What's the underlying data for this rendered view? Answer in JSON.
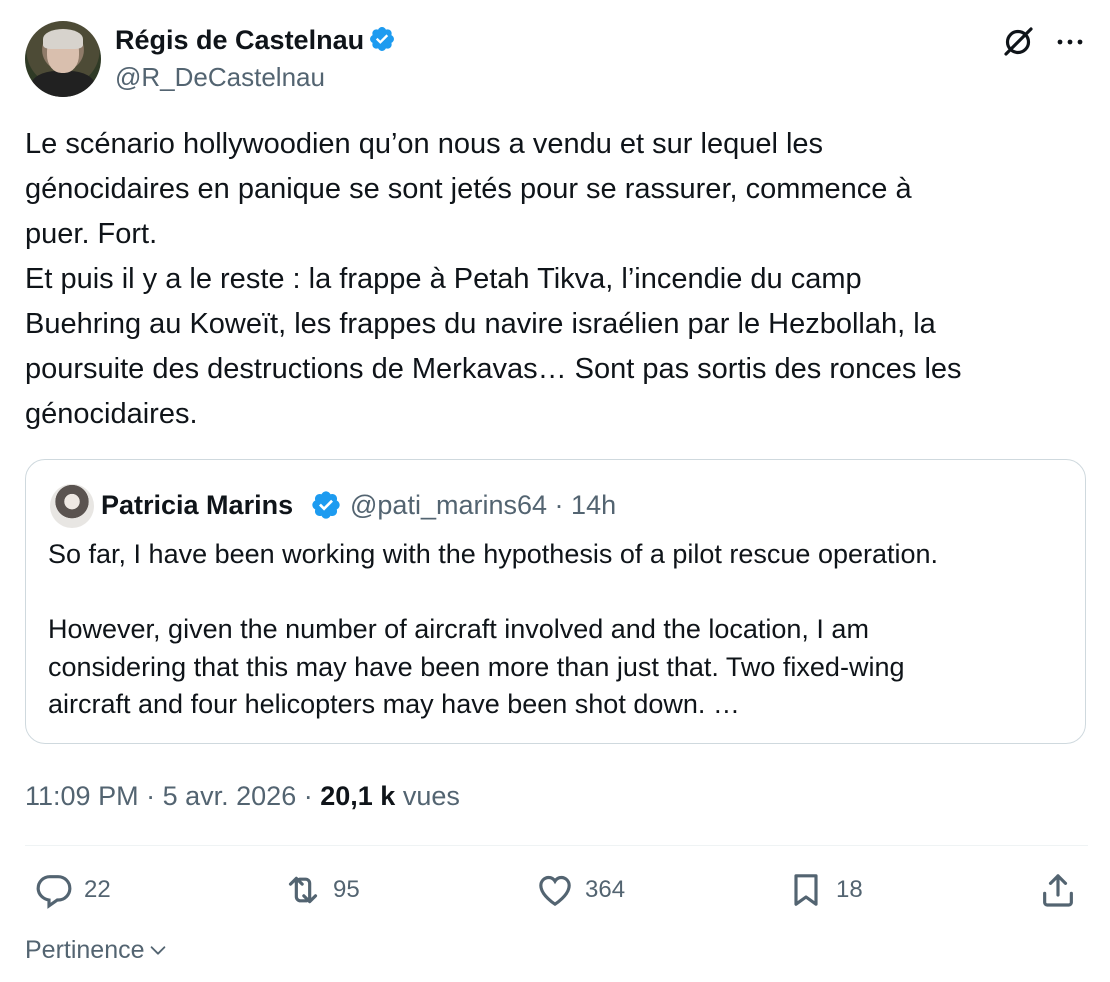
{
  "author": {
    "name": "Régis de Castelnau",
    "handle": "@R_DeCastelnau",
    "verified_color": "#1d9bf0"
  },
  "tweet": {
    "text": "Le scénario hollywoodien qu’on nous a vendu et sur lequel les\ngénocidaires en panique se sont jetés pour se rassurer, commence à\npuer. Fort.\nEt puis il y a le reste : la frappe à Petah Tikva, l’incendie du camp\nBuehring au Koweït, les frappes du navire israélien par le Hezbollah, la\npoursuite des destructions de Merkavas… Sont pas sortis des ronces les\ngénocidaires."
  },
  "quoted": {
    "name": "Patricia Marins",
    "handle": "@pati_marins64",
    "separator": "·",
    "time": "14h",
    "text": "So far, I have been working with the hypothesis of a pilot rescue operation.\n\nHowever, given the number of aircraft involved and the location, I am\nconsidering that this may have been more than just that. Two fixed-wing\naircraft and four helicopters may have been shot down. …"
  },
  "meta": {
    "time": "11:09 PM",
    "sep1": "·",
    "date": "5 avr. 2026",
    "sep2": "·",
    "views_count": "20,1 k",
    "views_label": "vues"
  },
  "actions": {
    "replies": "22",
    "reposts": "95",
    "likes": "364",
    "bookmarks": "18"
  },
  "sort": {
    "label": "Pertinence"
  },
  "icons": [
    "grok-icon",
    "more-icon",
    "reply-icon",
    "repost-icon",
    "like-icon",
    "bookmark-icon",
    "share-icon",
    "chevron-down-icon",
    "verified-icon"
  ],
  "colors": {
    "text": "#0f1419",
    "secondary": "#536471",
    "border": "#cfd9de",
    "verified": "#1d9bf0"
  }
}
